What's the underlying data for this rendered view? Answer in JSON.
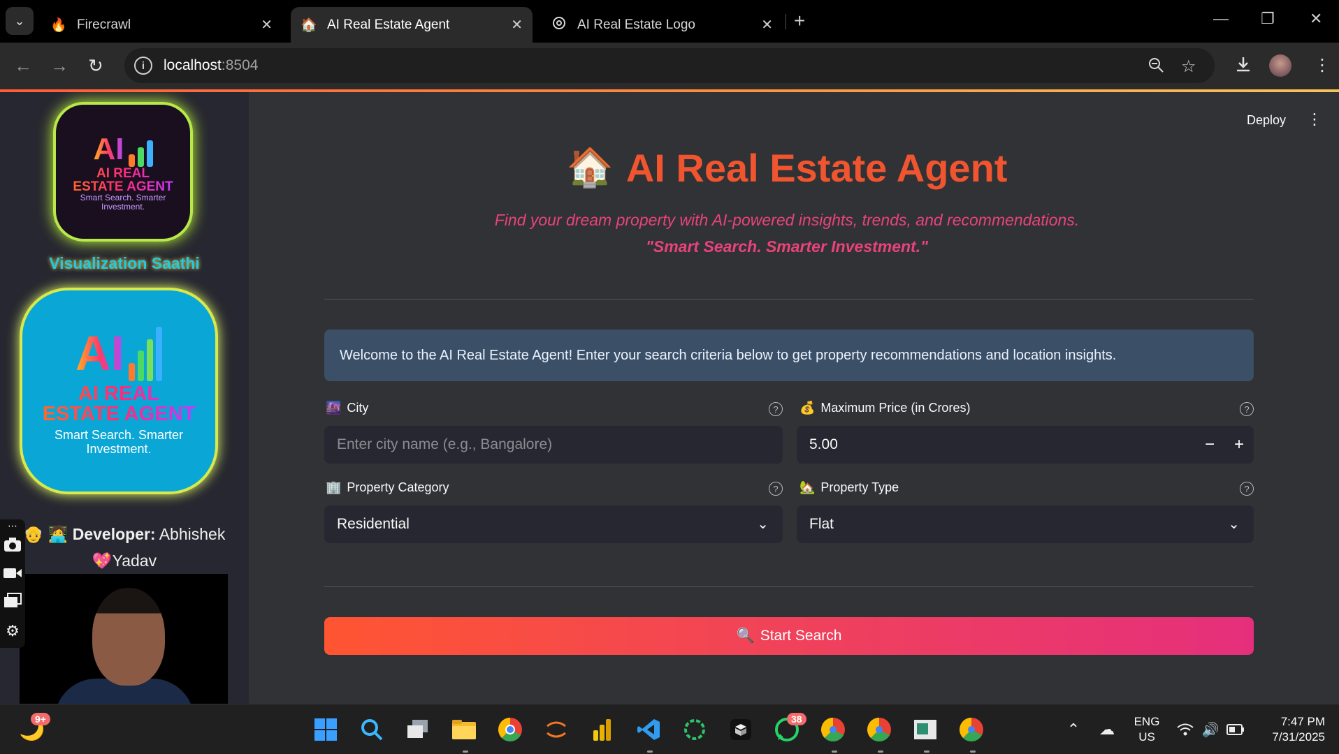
{
  "browser": {
    "tabs": [
      {
        "title": "Firecrawl",
        "icon": "fire-icon"
      },
      {
        "title": "AI Real Estate Agent",
        "icon": "house-icon"
      },
      {
        "title": "AI Real Estate Logo",
        "icon": "openai-icon"
      }
    ],
    "url_host": "localhost",
    "url_port": ":8504"
  },
  "sidebar": {
    "logo_small": {
      "ai": "AI",
      "title": "AI REAL ESTATE AGENT",
      "tagline": "Smart Search. Smarter Investment."
    },
    "brand_name": "Visualization Saathi",
    "logo_big": {
      "ai": "AI",
      "title": "AI REAL ESTATE AGENT",
      "tagline": "Smart Search. Smarter Investment."
    },
    "developer_emojis": "👴 🧑‍💻",
    "developer_label": "Developer:",
    "developer_name": "Abhishek",
    "developer_heart": "💖",
    "developer_surname": "Yadav"
  },
  "header": {
    "deploy_label": "Deploy"
  },
  "main": {
    "title_icon": "🏠",
    "title": "AI Real Estate Agent",
    "subtitle": "Find your dream property with AI-powered insights, trends, and recommendations.",
    "tagline": "\"Smart Search. Smarter Investment.\"",
    "info_message": "Welcome to the AI Real Estate Agent! Enter your search criteria below to get property recommendations and location insights.",
    "fields": {
      "city": {
        "emoji": "🌆",
        "label": "City",
        "placeholder": "Enter city name (e.g., Bangalore)",
        "value": ""
      },
      "max_price": {
        "emoji": "💰",
        "label": "Maximum Price (in Crores)",
        "value": "5.00",
        "minus": "−",
        "plus": "+"
      },
      "property_category": {
        "emoji": "🏢",
        "label": "Property Category",
        "value": "Residential"
      },
      "property_type": {
        "emoji": "🏡",
        "label": "Property Type",
        "value": "Flat"
      }
    },
    "search_button": {
      "emoji": "🔍",
      "label": "Start Search"
    }
  },
  "taskbar": {
    "weather_badge": "9+",
    "whatsapp_badge": "38",
    "lang_top": "ENG",
    "lang_bottom": "US",
    "time": "7:47 PM",
    "date": "7/31/2025"
  },
  "colors": {
    "title": "#f0552f",
    "subtitle": "#e9437a",
    "info_bg": "#3b4f66",
    "button_start": "#ff5532",
    "button_end": "#e52f7c",
    "brand_name": "#1ecbe1"
  }
}
